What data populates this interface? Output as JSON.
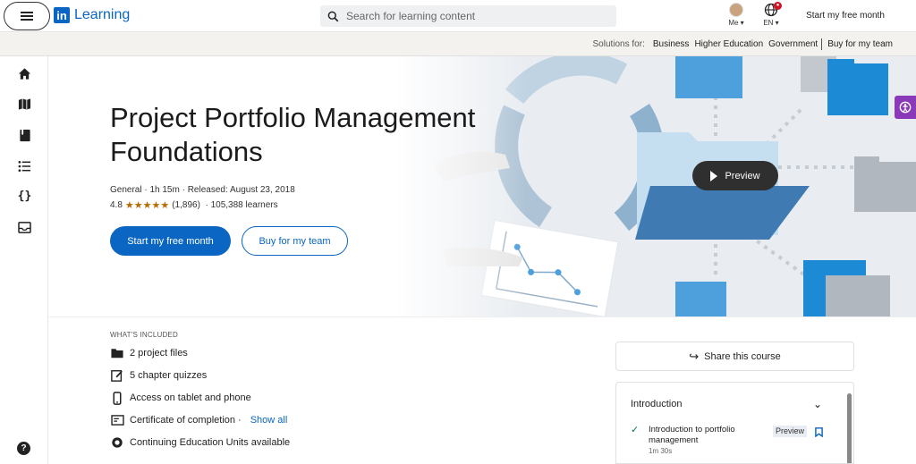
{
  "header": {
    "logo_text": "Learning",
    "logo_mark": "in",
    "search_placeholder": "Search for learning content",
    "me_label": "Me",
    "lang_label": "EN",
    "start_free_month": "Start my free month"
  },
  "solutions_bar": {
    "label": "Solutions for:",
    "links": [
      "Business",
      "Higher Education",
      "Government",
      "Buy for my team"
    ]
  },
  "left_rail": {
    "items": [
      "home-icon",
      "map-icon",
      "book-icon",
      "list-icon",
      "code-braces-icon",
      "inbox-icon"
    ],
    "help_icon": "?"
  },
  "course": {
    "title": "Project Portfolio Management Foundations",
    "meta_line": "General  ·  1h 15m  ·  Released: August 23, 2018",
    "rating": "4.8",
    "stars": "★★★★★",
    "rating_count": "(1,896)",
    "learners": "·  105,388 learners",
    "primary_button": "Start my free month",
    "secondary_button": "Buy for my team",
    "preview_button": "Preview"
  },
  "included": {
    "heading": "WHAT'S INCLUDED",
    "items": [
      {
        "icon": "folder-icon",
        "label": "2 project files"
      },
      {
        "icon": "quiz-icon",
        "label": "5 chapter quizzes"
      },
      {
        "icon": "phone-icon",
        "label": "Access on tablet and phone"
      },
      {
        "icon": "certificate-icon",
        "label": "Certificate of completion  ·"
      },
      {
        "icon": "badge-icon",
        "label": "Continuing Education Units available"
      }
    ],
    "show_all": "Show all"
  },
  "sidebar_right": {
    "share_label": "Share this course",
    "toc": {
      "chapter": "Introduction",
      "lesson_title": "Introduction to portfolio management",
      "lesson_duration": "1m 30s",
      "lesson_badge": "Preview"
    }
  },
  "colors": {
    "brand": "#0a66c2",
    "rating": "#b56b00",
    "completed": "#057642"
  }
}
